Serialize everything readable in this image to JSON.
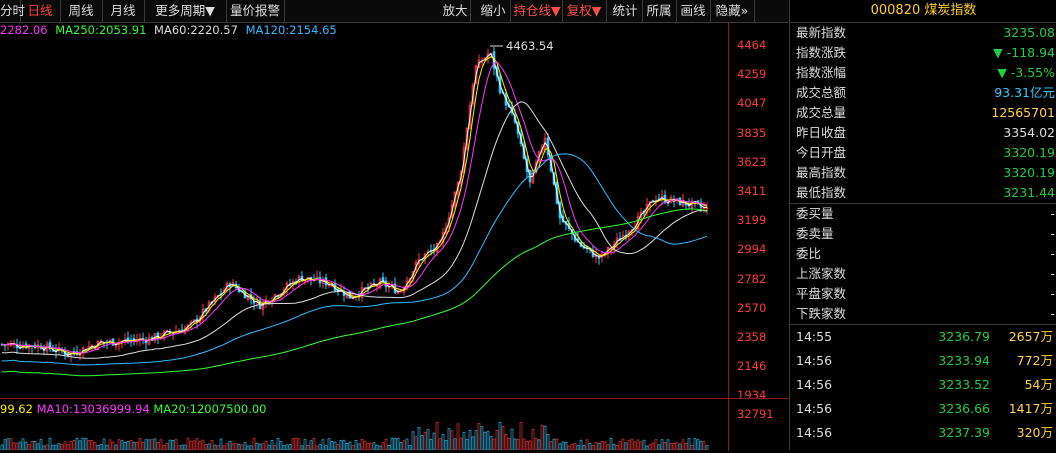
{
  "toolbar": {
    "items": [
      "分时",
      "日线",
      "周线",
      "月线",
      "更多周期▼",
      "量价报警",
      "放大",
      "缩小",
      "持仓线▼",
      "复权▼",
      "统计",
      "所属",
      "画线",
      "隐藏»"
    ]
  },
  "ma_legend": {
    "ma_a": "2282.06",
    "ma250": "MA250:2053.91",
    "ma60": "MA60:2220.57",
    "ma120": "MA120:2154.65"
  },
  "price_axis": [
    "4464",
    "4259",
    "4047",
    "3835",
    "3623",
    "3411",
    "3199",
    "2994",
    "2782",
    "2570",
    "2358",
    "2146",
    "1934"
  ],
  "peak_label": "4463.54",
  "vol_legend": {
    "a": "99.62",
    "ma10": "MA10:13036999.94",
    "ma20": "MA20:12007500.00"
  },
  "vol_axis": [
    "32791"
  ],
  "panel": {
    "title": "000820 煤炭指数",
    "rows": [
      {
        "label": "最新指数",
        "value": "3235.08",
        "color": "green"
      },
      {
        "label": "指数涨跌",
        "value": "▼ -118.94",
        "color": "green"
      },
      {
        "label": "指数涨幅",
        "value": "▼ -3.55%",
        "color": "green"
      },
      {
        "label": "成交总额",
        "value": "93.31亿元",
        "color": "cyan"
      },
      {
        "label": "成交总量",
        "value": "12565701",
        "color": "yellow"
      },
      {
        "label": "昨日收盘",
        "value": "3354.02",
        "color": "plain"
      },
      {
        "label": "今日开盘",
        "value": "3320.19",
        "color": "green"
      },
      {
        "label": "最高指数",
        "value": "3320.19",
        "color": "green"
      },
      {
        "label": "最低指数",
        "value": "3231.44",
        "color": "green"
      }
    ],
    "rows2": [
      {
        "label": "委买量",
        "value": "-"
      },
      {
        "label": "委卖量",
        "value": "-"
      },
      {
        "label": "委比",
        "value": "-"
      },
      {
        "label": "上涨家数",
        "value": "-"
      },
      {
        "label": "平盘家数",
        "value": "-"
      },
      {
        "label": "下跌家数",
        "value": "-"
      }
    ],
    "ticks": [
      {
        "time": "14:55",
        "price": "3236.79",
        "vol": "2657万"
      },
      {
        "time": "14:56",
        "price": "3233.94",
        "vol": "772万"
      },
      {
        "time": "14:56",
        "price": "3233.52",
        "vol": "54万"
      },
      {
        "time": "14:56",
        "price": "3236.66",
        "vol": "1417万"
      },
      {
        "time": "14:56",
        "price": "3237.39",
        "vol": "320万"
      }
    ]
  },
  "colors": {
    "up": "#ff3b3b",
    "down": "#33ccff",
    "ma5": "#ffffff",
    "ma10": "#ffee00",
    "ma20": "#ff33ff",
    "ma60": "#dddddd",
    "ma120": "#33bbff",
    "ma250": "#33ff33"
  }
}
